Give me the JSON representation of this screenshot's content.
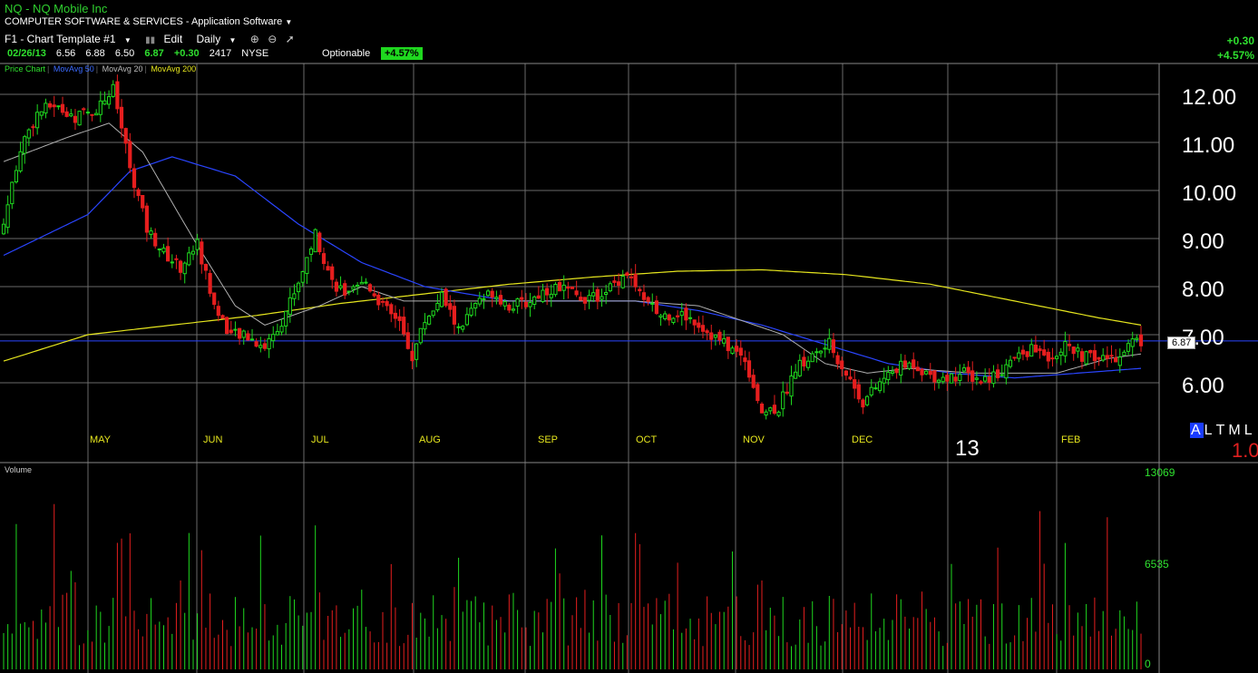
{
  "header": {
    "symbol_line": "NQ  -  NQ Mobile Inc",
    "industry": "COMPUTER SOFTWARE & SERVICES - Application Software",
    "industry_icon": "dropdown-triangle-icon",
    "template": "F1 - Chart Template #1",
    "edit_label": "Edit",
    "interval": "Daily",
    "icons": [
      "zoom-in-icon",
      "zoom-out-icon",
      "draw-line-icon"
    ]
  },
  "quote": {
    "date": "02/26/13",
    "open": "6.56",
    "high": "6.88",
    "low": "6.50",
    "last": "6.87",
    "change": "+0.30",
    "volume": "2417",
    "exchange": "NYSE",
    "optionable": "Optionable",
    "pct": "+4.57%"
  },
  "right_summary": {
    "change": "+0.30",
    "pct": "+4.57%"
  },
  "legend": {
    "price": "Price Chart",
    "ma50": "MovAvg 50",
    "ma20": "MovAvg 20",
    "ma200": "MovAvg 200"
  },
  "colors": {
    "up": "#1fd81f",
    "down": "#e61e1e",
    "ma50": "#2a45ff",
    "ma20": "#b0b0b0",
    "ma200": "#e6e61e",
    "grid": "#6a6a6a",
    "month_label": "#e6e61e",
    "price_line": "#2a45ff"
  },
  "chart_data": {
    "type": "candlestick",
    "y_ticks": [
      "12.00",
      "11.00",
      "10.00",
      "9.00",
      "8.00",
      "7.00",
      "6.00"
    ],
    "ylim": [
      5.1,
      12.8
    ],
    "months": [
      "MAY",
      "JUN",
      "JUL",
      "AUG",
      "SEP",
      "OCT",
      "NOV",
      "DEC",
      "FEB"
    ],
    "year_marker": "13",
    "current_price": "6.87",
    "last_close": 6.87,
    "ma_keypoints": {
      "ma20": [
        [
          0,
          10.6
        ],
        [
          15,
          11.1
        ],
        [
          25,
          11.4
        ],
        [
          33,
          10.8
        ],
        [
          45,
          9.0
        ],
        [
          55,
          7.6
        ],
        [
          62,
          7.2
        ],
        [
          75,
          7.6
        ],
        [
          85,
          8.0
        ],
        [
          95,
          7.7
        ],
        [
          110,
          7.7
        ],
        [
          130,
          7.7
        ],
        [
          150,
          7.7
        ],
        [
          165,
          7.6
        ],
        [
          175,
          7.3
        ],
        [
          185,
          7.0
        ],
        [
          195,
          6.4
        ],
        [
          205,
          6.2
        ],
        [
          215,
          6.3
        ],
        [
          230,
          6.2
        ],
        [
          250,
          6.2
        ],
        [
          262,
          6.5
        ],
        [
          270,
          6.6
        ]
      ],
      "ma50": [
        [
          0,
          8.65
        ],
        [
          20,
          9.5
        ],
        [
          30,
          10.4
        ],
        [
          40,
          10.7
        ],
        [
          55,
          10.3
        ],
        [
          70,
          9.3
        ],
        [
          85,
          8.5
        ],
        [
          100,
          8.0
        ],
        [
          120,
          7.7
        ],
        [
          140,
          7.7
        ],
        [
          150,
          7.7
        ],
        [
          165,
          7.5
        ],
        [
          180,
          7.2
        ],
        [
          195,
          6.8
        ],
        [
          210,
          6.4
        ],
        [
          225,
          6.2
        ],
        [
          240,
          6.1
        ],
        [
          255,
          6.2
        ],
        [
          270,
          6.3
        ]
      ],
      "ma200": [
        [
          0,
          6.45
        ],
        [
          20,
          7.0
        ],
        [
          40,
          7.2
        ],
        [
          60,
          7.4
        ],
        [
          80,
          7.65
        ],
        [
          100,
          7.85
        ],
        [
          120,
          8.05
        ],
        [
          140,
          8.2
        ],
        [
          160,
          8.32
        ],
        [
          180,
          8.35
        ],
        [
          200,
          8.25
        ],
        [
          220,
          8.05
        ],
        [
          240,
          7.7
        ],
        [
          260,
          7.35
        ],
        [
          270,
          7.2
        ]
      ]
    },
    "price_keypoints": [
      [
        0,
        9.3
      ],
      [
        4,
        10.9
      ],
      [
        8,
        11.6
      ],
      [
        12,
        11.8
      ],
      [
        16,
        11.5
      ],
      [
        22,
        11.7
      ],
      [
        26,
        12.1
      ],
      [
        30,
        10.5
      ],
      [
        34,
        9.2
      ],
      [
        38,
        8.7
      ],
      [
        42,
        8.4
      ],
      [
        46,
        8.9
      ],
      [
        50,
        7.6
      ],
      [
        54,
        7.0
      ],
      [
        58,
        6.95
      ],
      [
        62,
        6.75
      ],
      [
        66,
        7.3
      ],
      [
        70,
        8.1
      ],
      [
        74,
        9.1
      ],
      [
        78,
        8.1
      ],
      [
        82,
        7.8
      ],
      [
        86,
        8.1
      ],
      [
        90,
        7.6
      ],
      [
        94,
        7.2
      ],
      [
        97,
        6.55
      ],
      [
        100,
        7.3
      ],
      [
        104,
        7.8
      ],
      [
        108,
        7.1
      ],
      [
        112,
        7.6
      ],
      [
        116,
        7.9
      ],
      [
        120,
        7.6
      ],
      [
        124,
        7.65
      ],
      [
        128,
        7.9
      ],
      [
        132,
        8.0
      ],
      [
        136,
        7.8
      ],
      [
        140,
        7.75
      ],
      [
        144,
        8.0
      ],
      [
        148,
        8.3
      ],
      [
        152,
        7.7
      ],
      [
        156,
        7.4
      ],
      [
        160,
        7.45
      ],
      [
        164,
        7.3
      ],
      [
        168,
        7.0
      ],
      [
        172,
        6.75
      ],
      [
        176,
        6.5
      ],
      [
        180,
        5.4
      ],
      [
        184,
        5.5
      ],
      [
        188,
        6.3
      ],
      [
        192,
        6.55
      ],
      [
        196,
        6.8
      ],
      [
        200,
        6.2
      ],
      [
        204,
        5.6
      ],
      [
        208,
        6.0
      ],
      [
        212,
        6.3
      ],
      [
        216,
        6.4
      ],
      [
        220,
        6.15
      ],
      [
        224,
        6.1
      ],
      [
        228,
        6.2
      ],
      [
        232,
        6.05
      ],
      [
        236,
        6.2
      ],
      [
        240,
        6.5
      ],
      [
        244,
        6.7
      ],
      [
        248,
        6.55
      ],
      [
        252,
        6.75
      ],
      [
        256,
        6.55
      ],
      [
        260,
        6.5
      ],
      [
        264,
        6.55
      ],
      [
        268,
        6.87
      ]
    ],
    "volume_ticks": [
      "13069",
      "6535",
      "0"
    ],
    "volume_label": "Volume",
    "volume_max": 13069
  },
  "scale_value": "1.0",
  "period_buttons": [
    "A",
    "L",
    "T",
    "M",
    "L"
  ]
}
